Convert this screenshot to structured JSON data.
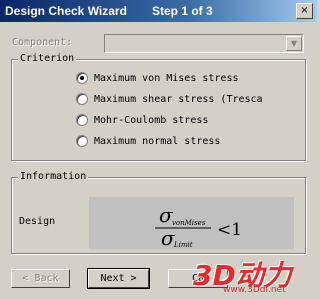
{
  "window": {
    "title": "Design Check Wizard",
    "step": "Step 1 of 3",
    "close_glyph": "×"
  },
  "component": {
    "label": "Component:",
    "value": "",
    "arrow": "▼"
  },
  "criterion": {
    "title": "Criterion",
    "options": [
      {
        "label": "Maximum von Mises stress",
        "checked": true
      },
      {
        "label": "Maximum shear stress (Tresca",
        "checked": false
      },
      {
        "label": "Mohr-Coulomb stress",
        "checked": false
      },
      {
        "label": "Maximum normal stress",
        "checked": false
      }
    ]
  },
  "information": {
    "title": "Information",
    "design_label": "Design",
    "formula": {
      "numerator": "σ",
      "numerator_sub": "vonMises",
      "denominator": "σ",
      "denominator_sub": "Limit",
      "relation": "<1"
    }
  },
  "buttons": {
    "back": "< Back",
    "next": "Next >",
    "cancel": "Ca"
  },
  "watermark": {
    "logo": "3D动力",
    "url": "www.3Ddl.net"
  }
}
